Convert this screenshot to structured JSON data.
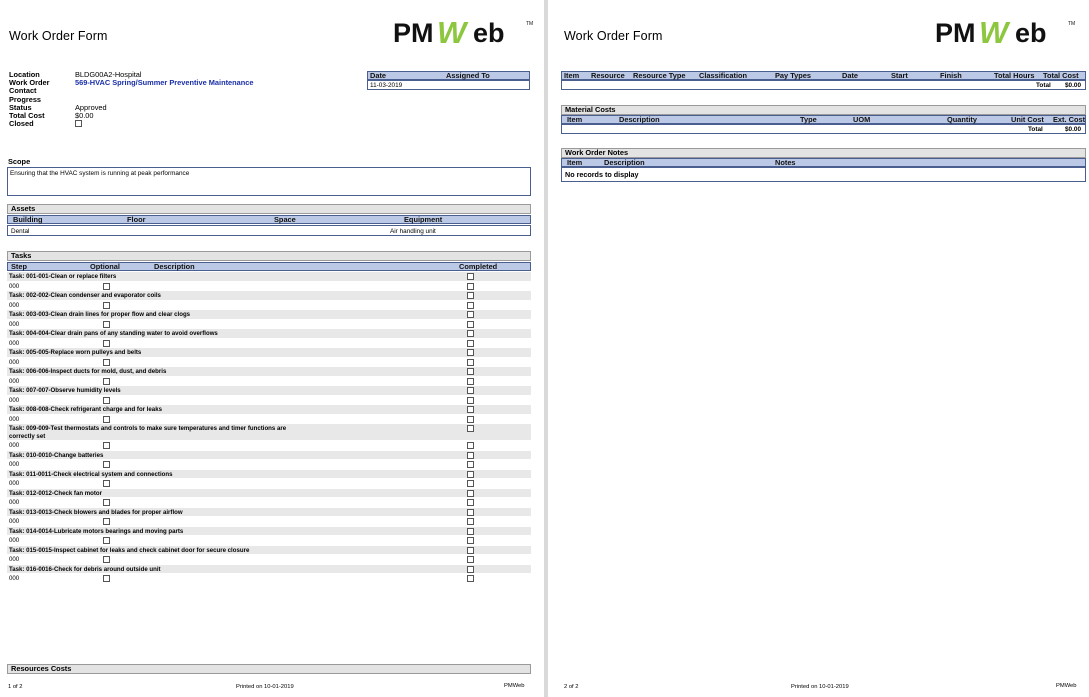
{
  "pages": [
    {
      "title": "Work Order Form",
      "logo_text": "PMWeb",
      "info": {
        "location_label": "Location",
        "location_value": "BLDG00A2-Hospital",
        "workorder_label": "Work Order",
        "workorder_value": "569-HVAC Spring/Summer Preventive Maintenance",
        "contact_label": "Contact",
        "contact_value": "",
        "progress_label": "Progress",
        "progress_value": "",
        "status_label": "Status",
        "status_value": "Approved",
        "totalcost_label": "Total Cost",
        "totalcost_value": "$0.00",
        "closed_label": "Closed"
      },
      "date_box": {
        "date_header": "Date",
        "assigned_header": "Assigned To",
        "date_value": "11-03-2019",
        "assigned_value": ""
      },
      "scope": {
        "title": "Scope",
        "text": "Ensuring that the HVAC system is running at peak performance"
      },
      "assets": {
        "title": "Assets",
        "headers": [
          "Building",
          "Floor",
          "Space",
          "Equipment"
        ],
        "row": [
          "Dental",
          "",
          "",
          "Air handling unit"
        ]
      },
      "tasks_section": {
        "title": "Tasks",
        "headers": {
          "step": "Step",
          "optional": "Optional",
          "description": "Description",
          "completed": "Completed"
        },
        "sub_step": "000",
        "items": [
          "Task: 001-001-Clean or replace filters",
          "Task: 002-002-Clean condenser and evaporator coils",
          "Task: 003-003-Clean drain lines for proper flow and clear clogs",
          "Task: 004-004-Clear drain pans of any standing water to avoid overflows",
          "Task: 005-005-Replace worn pulleys and belts",
          "Task: 006-006-Inspect ducts for mold, dust, and debris",
          "Task: 007-007-Observe humidity levels",
          "Task: 008-008-Check refrigerant charge and for leaks",
          "Task: 009-009-Test thermostats and controls to make sure temperatures and timer functions are correctly set",
          "Task: 010-0010-Change batteries",
          "Task: 011-0011-Check electrical system and connections",
          "Task: 012-0012-Check fan motor",
          "Task: 013-0013-Check blowers and blades for proper airflow",
          "Task: 014-0014-Lubricate motors bearings and moving parts",
          "Task: 015-0015-Inspect cabinet for leaks and check cabinet door for secure closure",
          "Task: 016-0016-Check for debris around outside unit"
        ]
      },
      "resources_costs_title": "Resources Costs",
      "footer": {
        "page": "1 of 2",
        "printed": "Printed on 10-01-2019",
        "brand": "PMWeb"
      }
    },
    {
      "title": "Work Order Form",
      "logo_text": "PMWeb",
      "resources": {
        "headers": [
          "Item",
          "Resource",
          "Resource Type",
          "Classification",
          "Pay Types",
          "Date",
          "Start",
          "Finish",
          "Total Hours",
          "Total Cost"
        ],
        "total_label": "Total",
        "total_value": "$0.00"
      },
      "material": {
        "title": "Material Costs",
        "headers": [
          "Item",
          "Description",
          "Type",
          "UOM",
          "Quantity",
          "Unit Cost",
          "Ext. Cost"
        ],
        "total_label": "Total",
        "total_value": "$0.00"
      },
      "notes": {
        "title": "Work Order Notes",
        "headers": [
          "Item",
          "Description",
          "Notes"
        ],
        "empty": "No records to display"
      },
      "footer": {
        "page": "2 of 2",
        "printed": "Printed on 10-01-2019",
        "brand": "PMWeb"
      }
    }
  ]
}
